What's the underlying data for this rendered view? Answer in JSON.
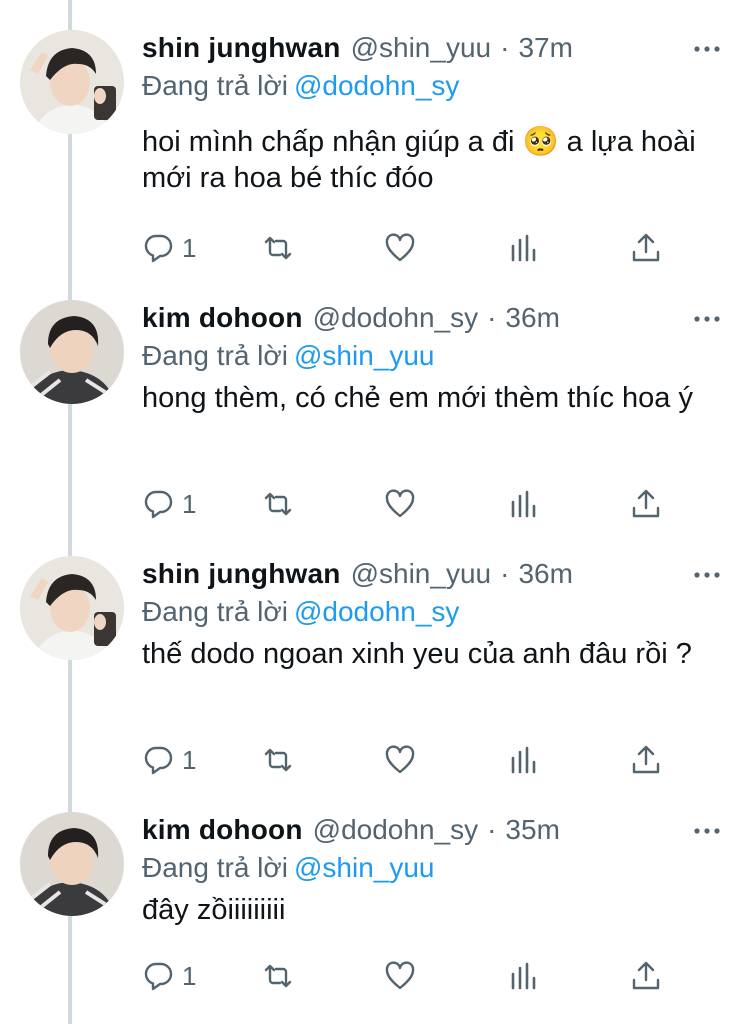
{
  "tweets": [
    {
      "name": "shin junghwan",
      "handle": "@shin_yuu",
      "time": "37m",
      "reply_prefix": "Đang trả lời",
      "reply_to": "@dodohn_sy",
      "text_a": "hoi mình chấp nhận giúp a đi",
      "emoji": "🥺",
      "text_b": " a lựa hoài mới ra hoa bé thíc đóo",
      "reply_count": "1",
      "avatar": "avatar-shin"
    },
    {
      "name": "kim dohoon",
      "handle": "@dodohn_sy",
      "time": "36m",
      "reply_prefix": "Đang trả lời",
      "reply_to": "@shin_yuu",
      "text": "hong thèm, có chẻ em mới thèm thíc hoa ý",
      "reply_count": "1",
      "avatar": "avatar-kim"
    },
    {
      "name": "shin junghwan",
      "handle": "@shin_yuu",
      "time": "36m",
      "reply_prefix": "Đang trả lời",
      "reply_to": "@dodohn_sy",
      "text": "thế dodo ngoan xinh yeu của anh đâu rồi ?",
      "reply_count": "1",
      "avatar": "avatar-shin"
    },
    {
      "name": "kim dohoon",
      "handle": "@dodohn_sy",
      "time": "35m",
      "reply_prefix": "Đang trả lời",
      "reply_to": "@shin_yuu",
      "text": "đây zồiiiiiiiii",
      "reply_count": "1",
      "avatar": "avatar-kim"
    }
  ],
  "colors": {
    "accent": "#1d9bf0",
    "text": "#0f1419",
    "secondary": "#536471",
    "thread_line": "#cfd9de"
  },
  "icons": [
    "reply-icon",
    "retweet-icon",
    "like-icon",
    "analytics-icon",
    "share-icon",
    "more-icon"
  ]
}
